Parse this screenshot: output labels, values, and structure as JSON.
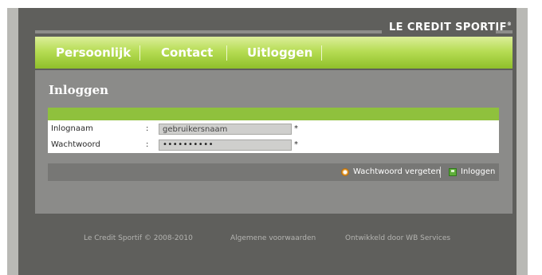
{
  "brand": {
    "name": "LE CREDIT SPORTIF",
    "mark": "®"
  },
  "nav": [
    {
      "label": "Persoonlijk"
    },
    {
      "label": "Contact"
    },
    {
      "label": "Uitloggen"
    }
  ],
  "page": {
    "title": "Inloggen"
  },
  "form": {
    "username_label": "Inlognaam",
    "username_value": "gebruikersnaam",
    "password_label": "Wachtwoord",
    "password_value": "••••••••••",
    "separator": ":",
    "required_mark": "*"
  },
  "actions": {
    "forgot_label": "Wachtwoord vergeten",
    "login_label": "Inloggen"
  },
  "footer": {
    "copyright": "Le Credit Sportif © 2008-2010",
    "terms": "Algemene voorwaarden",
    "developer": "Ontwikkeld door WB Services"
  },
  "colors": {
    "accent_green": "#8fc13d",
    "background_dark": "#5f5f5c",
    "panel": "#8b8b89"
  }
}
